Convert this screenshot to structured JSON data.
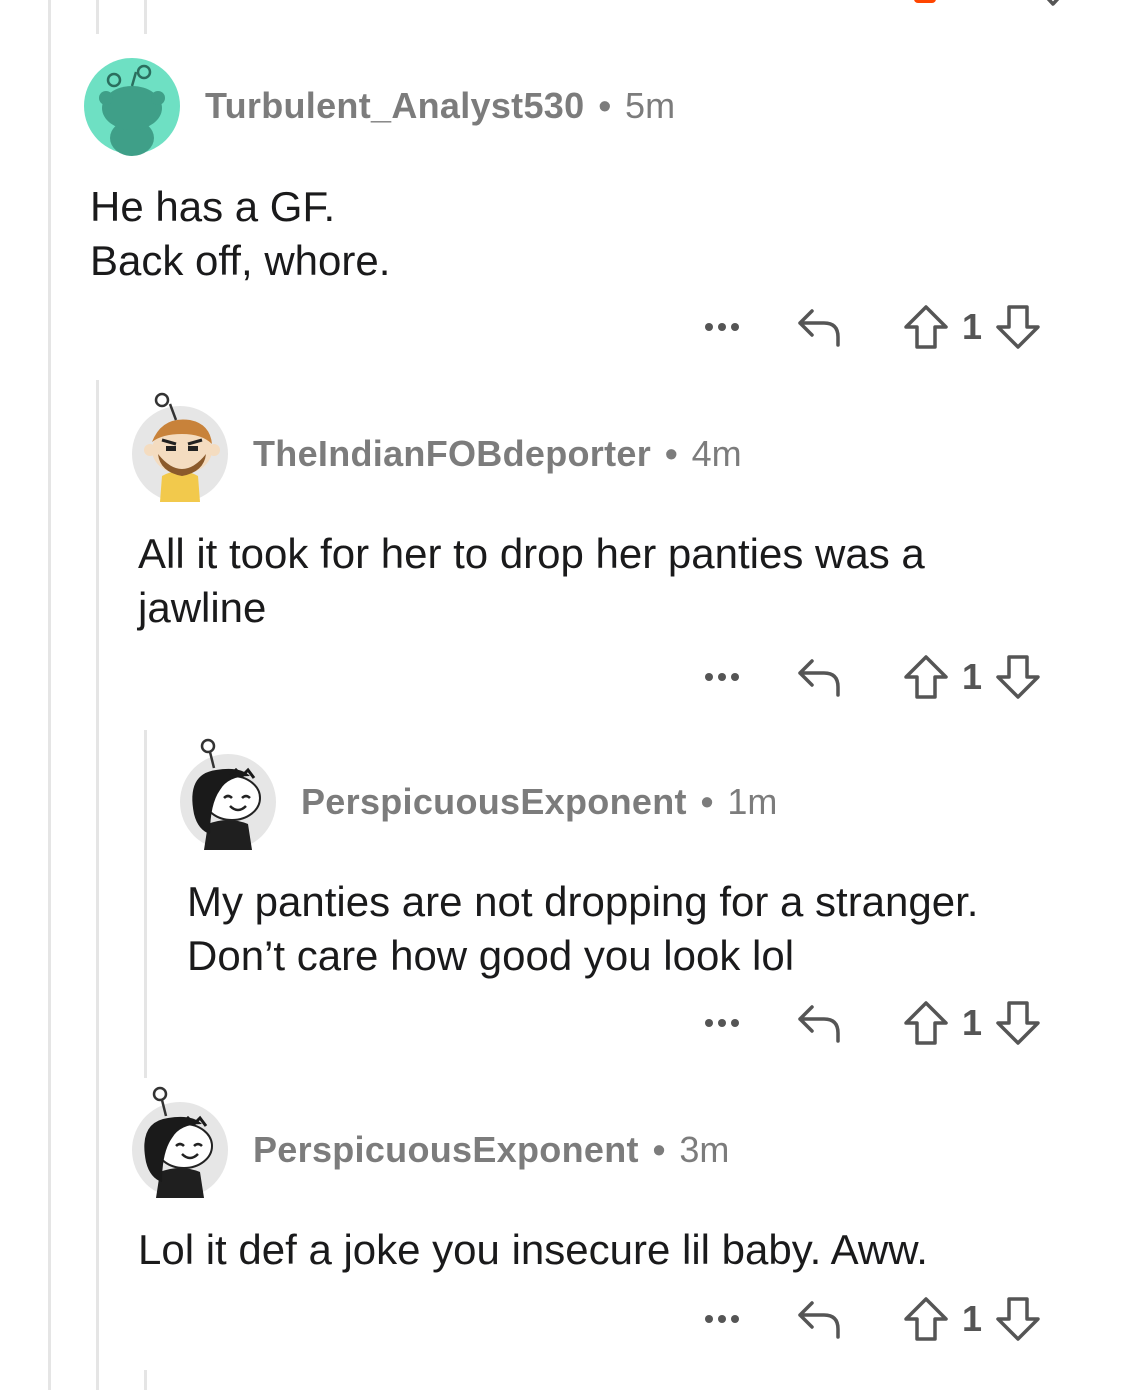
{
  "colors": {
    "thread_line": "#e5e5e5",
    "meta_text": "#7c7c7c",
    "body_text": "#1a1a1b",
    "icon_stroke": "#555555",
    "avatar_teal": "#6ee0c3",
    "avatar_gray_bg": "#e6e6e6",
    "accent_orange": "#ff4500"
  },
  "comments": [
    {
      "username": "Turbulent_Analyst530",
      "separator": "•",
      "age": "5m",
      "lines": [
        "He has a GF.",
        "Back off, whore."
      ],
      "votes": "1",
      "avatar": "snoo-default-teal"
    },
    {
      "username": "TheIndianFOBdeporter",
      "separator": "•",
      "age": "4m",
      "lines": [
        "All it took for her to drop her panties was a",
        "jawline"
      ],
      "votes": "1",
      "avatar": "snoo-bearded-yellow-hoodie"
    },
    {
      "username": "PerspicuousExponent",
      "separator": "•",
      "age": "1m",
      "lines": [
        "My panties are not dropping for a stranger.",
        "Don’t care how good you look lol"
      ],
      "votes": "1",
      "avatar": "snoo-black-hair"
    },
    {
      "username": "PerspicuousExponent",
      "separator": "•",
      "age": "3m",
      "lines": [
        "Lol it def a joke you insecure lil baby. Aww."
      ],
      "votes": "1",
      "avatar": "snoo-black-hair"
    }
  ],
  "action_icons": [
    "more-options-icon",
    "reply-icon",
    "upvote-icon",
    "downvote-icon"
  ]
}
